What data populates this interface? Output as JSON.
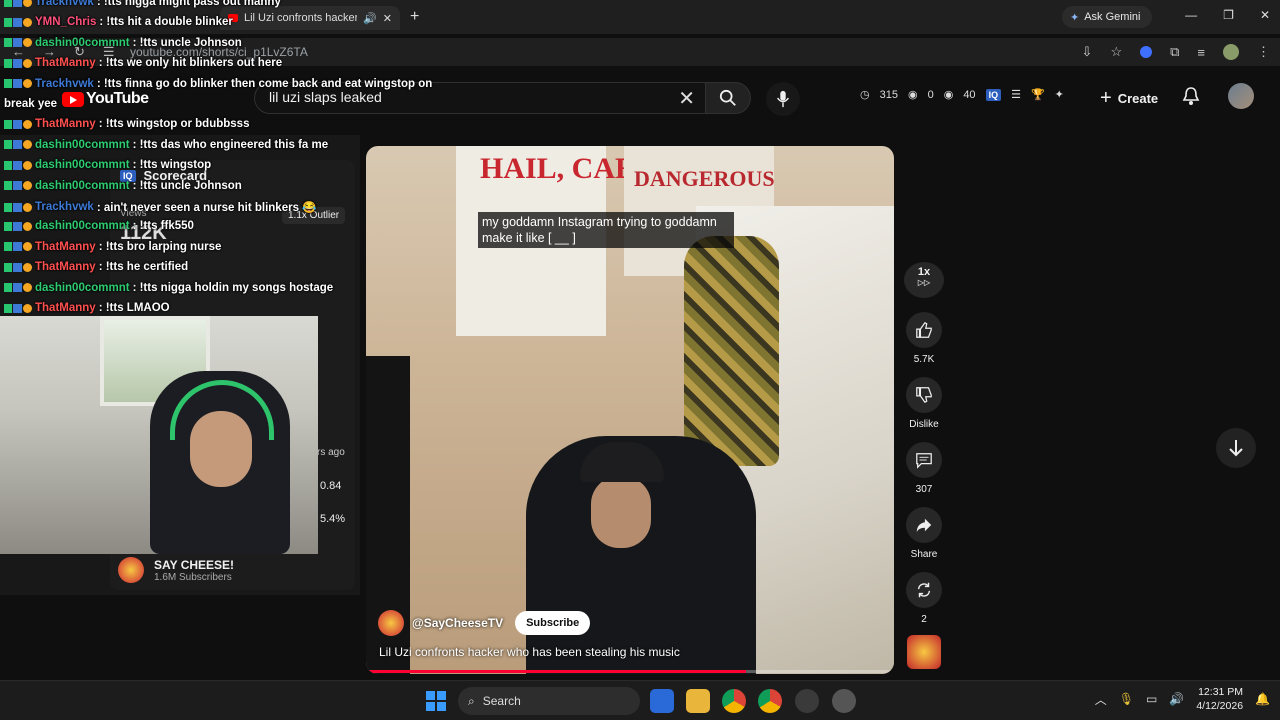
{
  "browser": {
    "tab_title": "Lil Uzi confronts hacker wh",
    "gemini_label": "Ask Gemini",
    "url": "youtube.com/shorts/ci_p1LvZ6TA"
  },
  "yt_header": {
    "logo_text": "YouTube",
    "search_value": "lil uzi slaps leaked",
    "stat_a": "315",
    "stat_b": "0",
    "stat_c": "40",
    "iq_badge": "IQ",
    "create_label": "Create"
  },
  "scorecard": {
    "title": "Scorecard",
    "iq_badge": "IQ",
    "views_label": "Views",
    "views_value": "112K",
    "outlier": "1.1x Outlier",
    "ago": "rs ago",
    "metric_a": "0.84",
    "metric_b": "5.4%"
  },
  "channel_card": {
    "name": "SAY CHEESE!",
    "subs": "1.6M Subscribers"
  },
  "chat": [
    {
      "user": "Trackhvwk",
      "color": "#3d7ad6",
      "msg": ": !tts nigga might pass out manny"
    },
    {
      "user": "YMN_Chris",
      "color": "#ff4f7b",
      "msg": ": !tts hit a double blinker"
    },
    {
      "user": "dashin00commnt",
      "color": "#2ecc71",
      "msg": ": !tts uncle Johnson"
    },
    {
      "user": "ThatManny",
      "color": "#ff4f4f",
      "msg": ": !tts we only hit blinkers out here"
    },
    {
      "user": "Trackhvwk",
      "color": "#3d7ad6",
      "msg": ": !tts finna go do blinker then come back and eat wingstop on"
    },
    {
      "user": "",
      "color": "#ffffff",
      "msg": "break yee"
    },
    {
      "user": "ThatManny",
      "color": "#ff4f4f",
      "msg": ": !tts wingstop or bdubbsss"
    },
    {
      "user": "dashin00commnt",
      "color": "#2ecc71",
      "msg": ": !tts das who engineered this fa me"
    },
    {
      "user": "dashin00commnt",
      "color": "#2ecc71",
      "msg": ": !tts wingstop"
    },
    {
      "user": "dashin00commnt",
      "color": "#2ecc71",
      "msg": ": !tts uncle Johnson"
    },
    {
      "user": "Trackhvwk",
      "color": "#3d7ad6",
      "msg": ": ain't never seen a nurse hit blinkers 😂"
    },
    {
      "user": "dashin00commnt",
      "color": "#2ecc71",
      "msg": ": !tts ffk550"
    },
    {
      "user": "ThatManny",
      "color": "#ff4f4f",
      "msg": ": !tts bro larping nurse"
    },
    {
      "user": "ThatManny",
      "color": "#ff4f4f",
      "msg": ": !tts he certified"
    },
    {
      "user": "dashin00commnt",
      "color": "#2ecc71",
      "msg": ": !tts nigga holdin my songs hostage"
    },
    {
      "user": "ThatManny",
      "color": "#ff4f4f",
      "msg": ": !tts LMAOO"
    }
  ],
  "video": {
    "poster_text_1": "HAIL, CAESAR!",
    "poster_text_2": "DANGEROUS",
    "caption": "my goddamn Instagram trying to goddamn make it like [ __ ]",
    "channel_handle": "@SayCheeseTV",
    "subscribe_label": "Subscribe",
    "title": "Lil Uzi confronts hacker who has been stealing his music",
    "progress": 0.72
  },
  "rail": {
    "speed": "1x",
    "likes": "5.7K",
    "dislike_label": "Dislike",
    "comments": "307",
    "share_label": "Share",
    "remix": "2"
  },
  "taskbar": {
    "search_label": "Search",
    "time": "12:31 PM",
    "date": "4/12/2026"
  },
  "colors": {
    "yt_red": "#ff0000",
    "progress_red": "#ff0033",
    "windows_blue": "#3a9bff"
  }
}
